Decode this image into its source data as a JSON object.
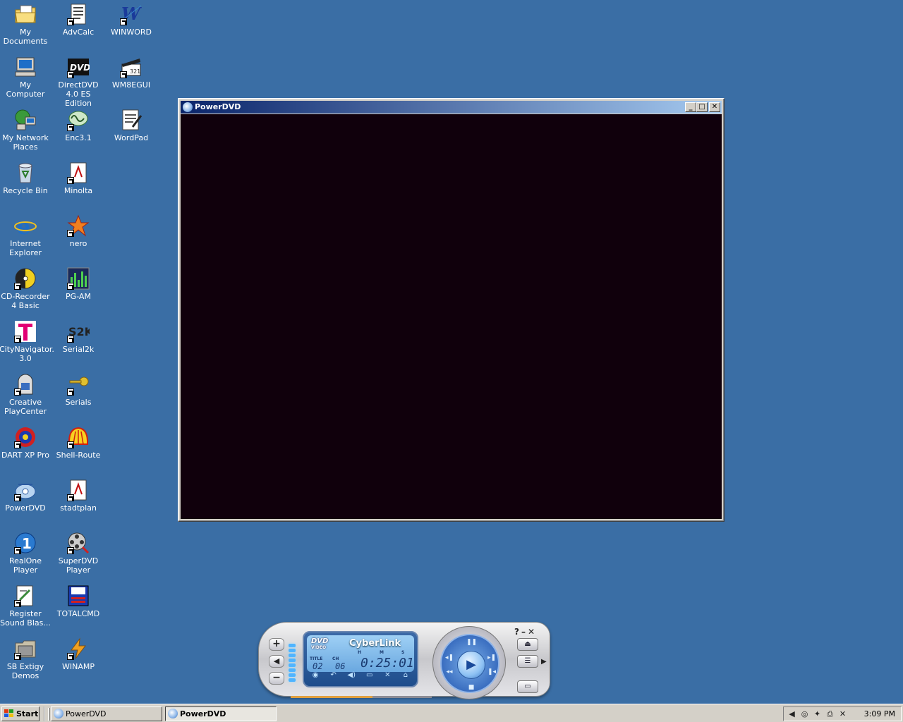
{
  "desktop": {
    "icons": [
      {
        "label": "My Documents",
        "icon": "folder-documents-icon"
      },
      {
        "label": "AdvCalc",
        "icon": "calculator-document-icon"
      },
      {
        "label": "WINWORD",
        "icon": "word-icon"
      },
      {
        "label": "My Computer",
        "icon": "computer-icon"
      },
      {
        "label": "DirectDVD 4.0 ES Edition",
        "icon": "dvd-icon"
      },
      {
        "label": "WM8EGUI",
        "icon": "clapboard-icon"
      },
      {
        "label": "My Network Places",
        "icon": "network-icon"
      },
      {
        "label": "Enc3.1",
        "icon": "encoder-icon"
      },
      {
        "label": "WordPad",
        "icon": "wordpad-icon"
      },
      {
        "label": "Recycle Bin",
        "icon": "recycle-bin-icon"
      },
      {
        "label": "Minolta",
        "icon": "pdf-icon"
      },
      {
        "label": "Internet Explorer",
        "icon": "internet-explorer-icon"
      },
      {
        "label": "nero",
        "icon": "nero-icon"
      },
      {
        "label": "CD-Recorder 4 Basic",
        "icon": "cd-recorder-icon"
      },
      {
        "label": "PG-AM",
        "icon": "equalizer-icon"
      },
      {
        "label": "CityNavigator. 3.0",
        "icon": "telekom-icon"
      },
      {
        "label": "Serial2k",
        "icon": "serial-icon"
      },
      {
        "label": "Creative PlayCenter",
        "icon": "jukebox-icon"
      },
      {
        "label": "Serials",
        "icon": "key-icon"
      },
      {
        "label": "DART XP Pro",
        "icon": "dart-icon"
      },
      {
        "label": "Shell-Route",
        "icon": "shell-icon"
      },
      {
        "label": "PowerDVD",
        "icon": "powerdvd-icon"
      },
      {
        "label": "stadtplan",
        "icon": "pdf-icon"
      },
      {
        "label": "RealOne Player",
        "icon": "realone-icon"
      },
      {
        "label": "SuperDVD Player",
        "icon": "film-reel-icon"
      },
      {
        "label": "Register Sound Blas...",
        "icon": "register-icon"
      },
      {
        "label": "TOTALCMD",
        "icon": "totalcmd-icon"
      },
      {
        "label": "SB Extigy Demos",
        "icon": "folder-icon"
      },
      {
        "label": "WINAMP",
        "icon": "winamp-icon"
      }
    ]
  },
  "video_window": {
    "title": "PowerDVD",
    "buttons": {
      "minimize": "_",
      "maximize": "□",
      "close": "✕"
    }
  },
  "player": {
    "brand": "CyberLink",
    "dvd_logo": "DVD",
    "dvd_logo_sub": "VIDEO",
    "labels": {
      "title": "TITLE",
      "chapter": "CH",
      "h": "H",
      "m": "M",
      "s": "S"
    },
    "title_num": "02",
    "chapter_num": "06",
    "time": "0:25:01",
    "top_controls": "?–✕",
    "progress_fraction": 0.58,
    "volume_level": 0.9
  },
  "taskbar": {
    "start_label": "Start",
    "tasks": [
      {
        "label": "PowerDVD",
        "active": false
      },
      {
        "label": "PowerDVD",
        "active": true
      }
    ],
    "clock": "3:09 PM"
  },
  "colors": {
    "desktop": "#3a6ea5",
    "title_active": "#0a246a",
    "video_bg": "#10000c",
    "lcd": "#1e4d8c"
  }
}
